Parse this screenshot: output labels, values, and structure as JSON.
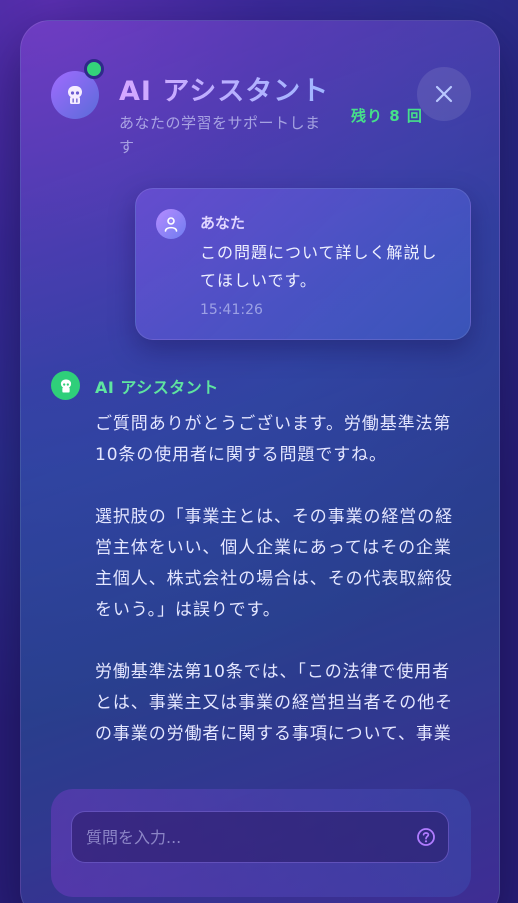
{
  "header": {
    "title": "AI アシスタント",
    "subtitle": "あなたの学習をサポートします",
    "remaining": "残り 8 回",
    "close_icon": "close-icon",
    "bot_icon": "robot-icon",
    "status": "online"
  },
  "messages": {
    "user": {
      "name": "あなた",
      "text": "この問題について詳しく解説してほしいです。",
      "time": "15:41:26",
      "icon": "user-icon"
    },
    "assistant": {
      "name": "AI アシスタント",
      "icon": "robot-icon",
      "paragraphs": [
        "ご質問ありがとうございます。労働基準法第10条の使用者に関する問題ですね。",
        "選択肢の「事業主とは、その事業の経営の経営主体をいい、個人企業にあってはその企業主個人、株式会社の場合は、その代表取締役をいう。」は誤りです。",
        "労働基準法第10条では、「この法律で使用者とは、事業主又は事業の経営担当者その他その事業の労働者に関する事項について、事業"
      ]
    }
  },
  "input": {
    "placeholder": "質問を入力...",
    "value": "",
    "help_icon": "help-icon"
  },
  "colors": {
    "accent_green": "#46e08a",
    "title_gradient_start": "#d5a8ff",
    "title_gradient_end": "#9fb6ff",
    "online": "#34d47a"
  }
}
